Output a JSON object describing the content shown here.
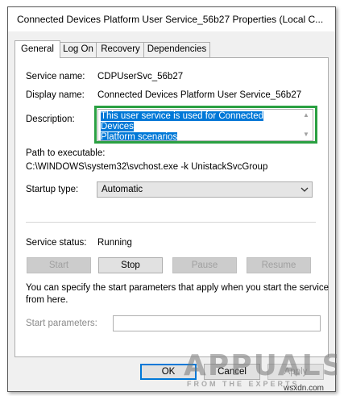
{
  "window": {
    "title": "Connected Devices Platform User Service_56b27 Properties (Local C..."
  },
  "tabs": [
    {
      "label": "General",
      "active": true
    },
    {
      "label": "Log On",
      "active": false
    },
    {
      "label": "Recovery",
      "active": false
    },
    {
      "label": "Dependencies",
      "active": false
    }
  ],
  "general": {
    "service_name_label": "Service name:",
    "service_name_value": "CDPUserSvc_56b27",
    "display_name_label": "Display name:",
    "display_name_value": "Connected Devices Platform User Service_56b27",
    "description_label": "Description:",
    "description_line1": "This user service is used for Connected Devices",
    "description_line2": "Platform scenarios",
    "path_label": "Path to executable:",
    "path_value": "C:\\WINDOWS\\system32\\svchost.exe -k UnistackSvcGroup",
    "startup_label": "Startup type:",
    "startup_value": "Automatic",
    "status_label": "Service status:",
    "status_value": "Running",
    "buttons": {
      "start": "Start",
      "stop": "Stop",
      "pause": "Pause",
      "resume": "Resume"
    },
    "hint_line1": "You can specify the start parameters that apply when you start the service",
    "hint_line2": "from here.",
    "params_label": "Start parameters:",
    "params_value": ""
  },
  "footer": {
    "ok": "OK",
    "cancel": "Cancel",
    "apply": "Apply"
  },
  "watermark": {
    "main": "APPUALS",
    "sub": "FROM THE EXPERTS",
    "site": "wsxdn.com"
  },
  "colors": {
    "selection": "#0078d7",
    "highlight_border": "#2aa042",
    "dialog_bg": "#f0f0f0"
  }
}
